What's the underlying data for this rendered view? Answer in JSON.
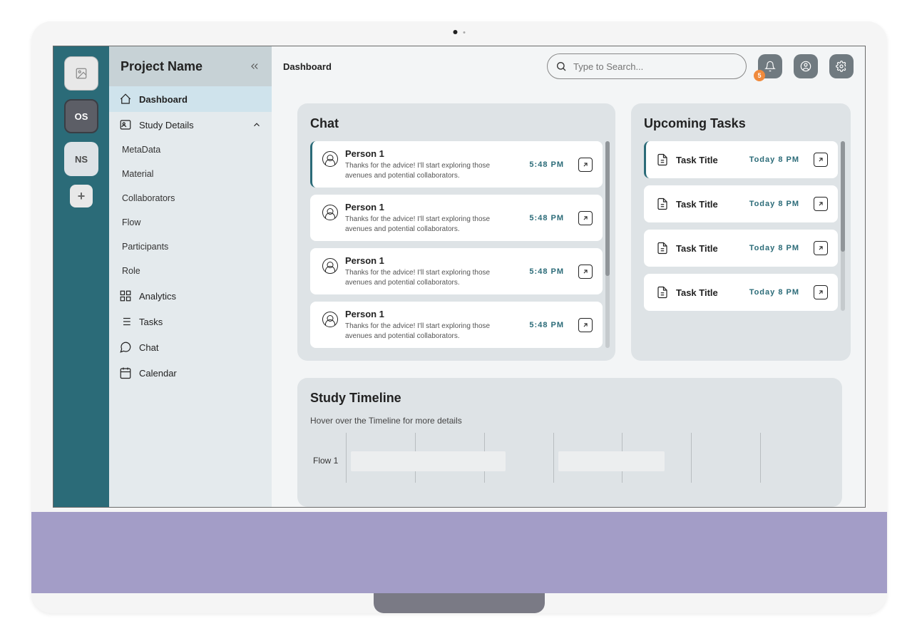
{
  "sidebar": {
    "title": "Project Name",
    "nav": {
      "dashboard": "Dashboard",
      "study": "Study Details",
      "meta": "MetaData",
      "material": "Material",
      "collaborators": "Collaborators",
      "flow": "Flow",
      "participants": "Participants",
      "role": "Role",
      "analytics": "Analytics",
      "tasks": "Tasks",
      "chat": "Chat",
      "calendar": "Calendar"
    }
  },
  "rail": {
    "os": "OS",
    "ns": "NS",
    "plus": "+"
  },
  "header": {
    "breadcrumb": "Dashboard",
    "search_placeholder": "Type to Search...",
    "badge": "5"
  },
  "chat": {
    "title": "Chat",
    "items": [
      {
        "name": "Person 1",
        "msg": "Thanks for the advice! I'll start exploring those avenues and potential collaborators.",
        "time": "5:48 PM"
      },
      {
        "name": "Person 1",
        "msg": "Thanks for the advice! I'll start exploring those avenues and potential collaborators.",
        "time": "5:48 PM"
      },
      {
        "name": "Person 1",
        "msg": "Thanks for the advice! I'll start exploring those avenues and potential collaborators.",
        "time": "5:48 PM"
      },
      {
        "name": "Person 1",
        "msg": "Thanks for the advice! I'll start exploring those avenues and potential collaborators.",
        "time": "5:48 PM"
      }
    ]
  },
  "tasks": {
    "title": "Upcoming Tasks",
    "items": [
      {
        "title": "Task Title",
        "time": "Today 8 PM"
      },
      {
        "title": "Task Title",
        "time": "Today 8 PM"
      },
      {
        "title": "Task Title",
        "time": "Today 8 PM"
      },
      {
        "title": "Task Title",
        "time": "Today 8 PM"
      }
    ]
  },
  "timeline": {
    "title": "Study Timeline",
    "subtitle": "Hover over the Timeline for more details",
    "flow_label": "Flow 1"
  }
}
